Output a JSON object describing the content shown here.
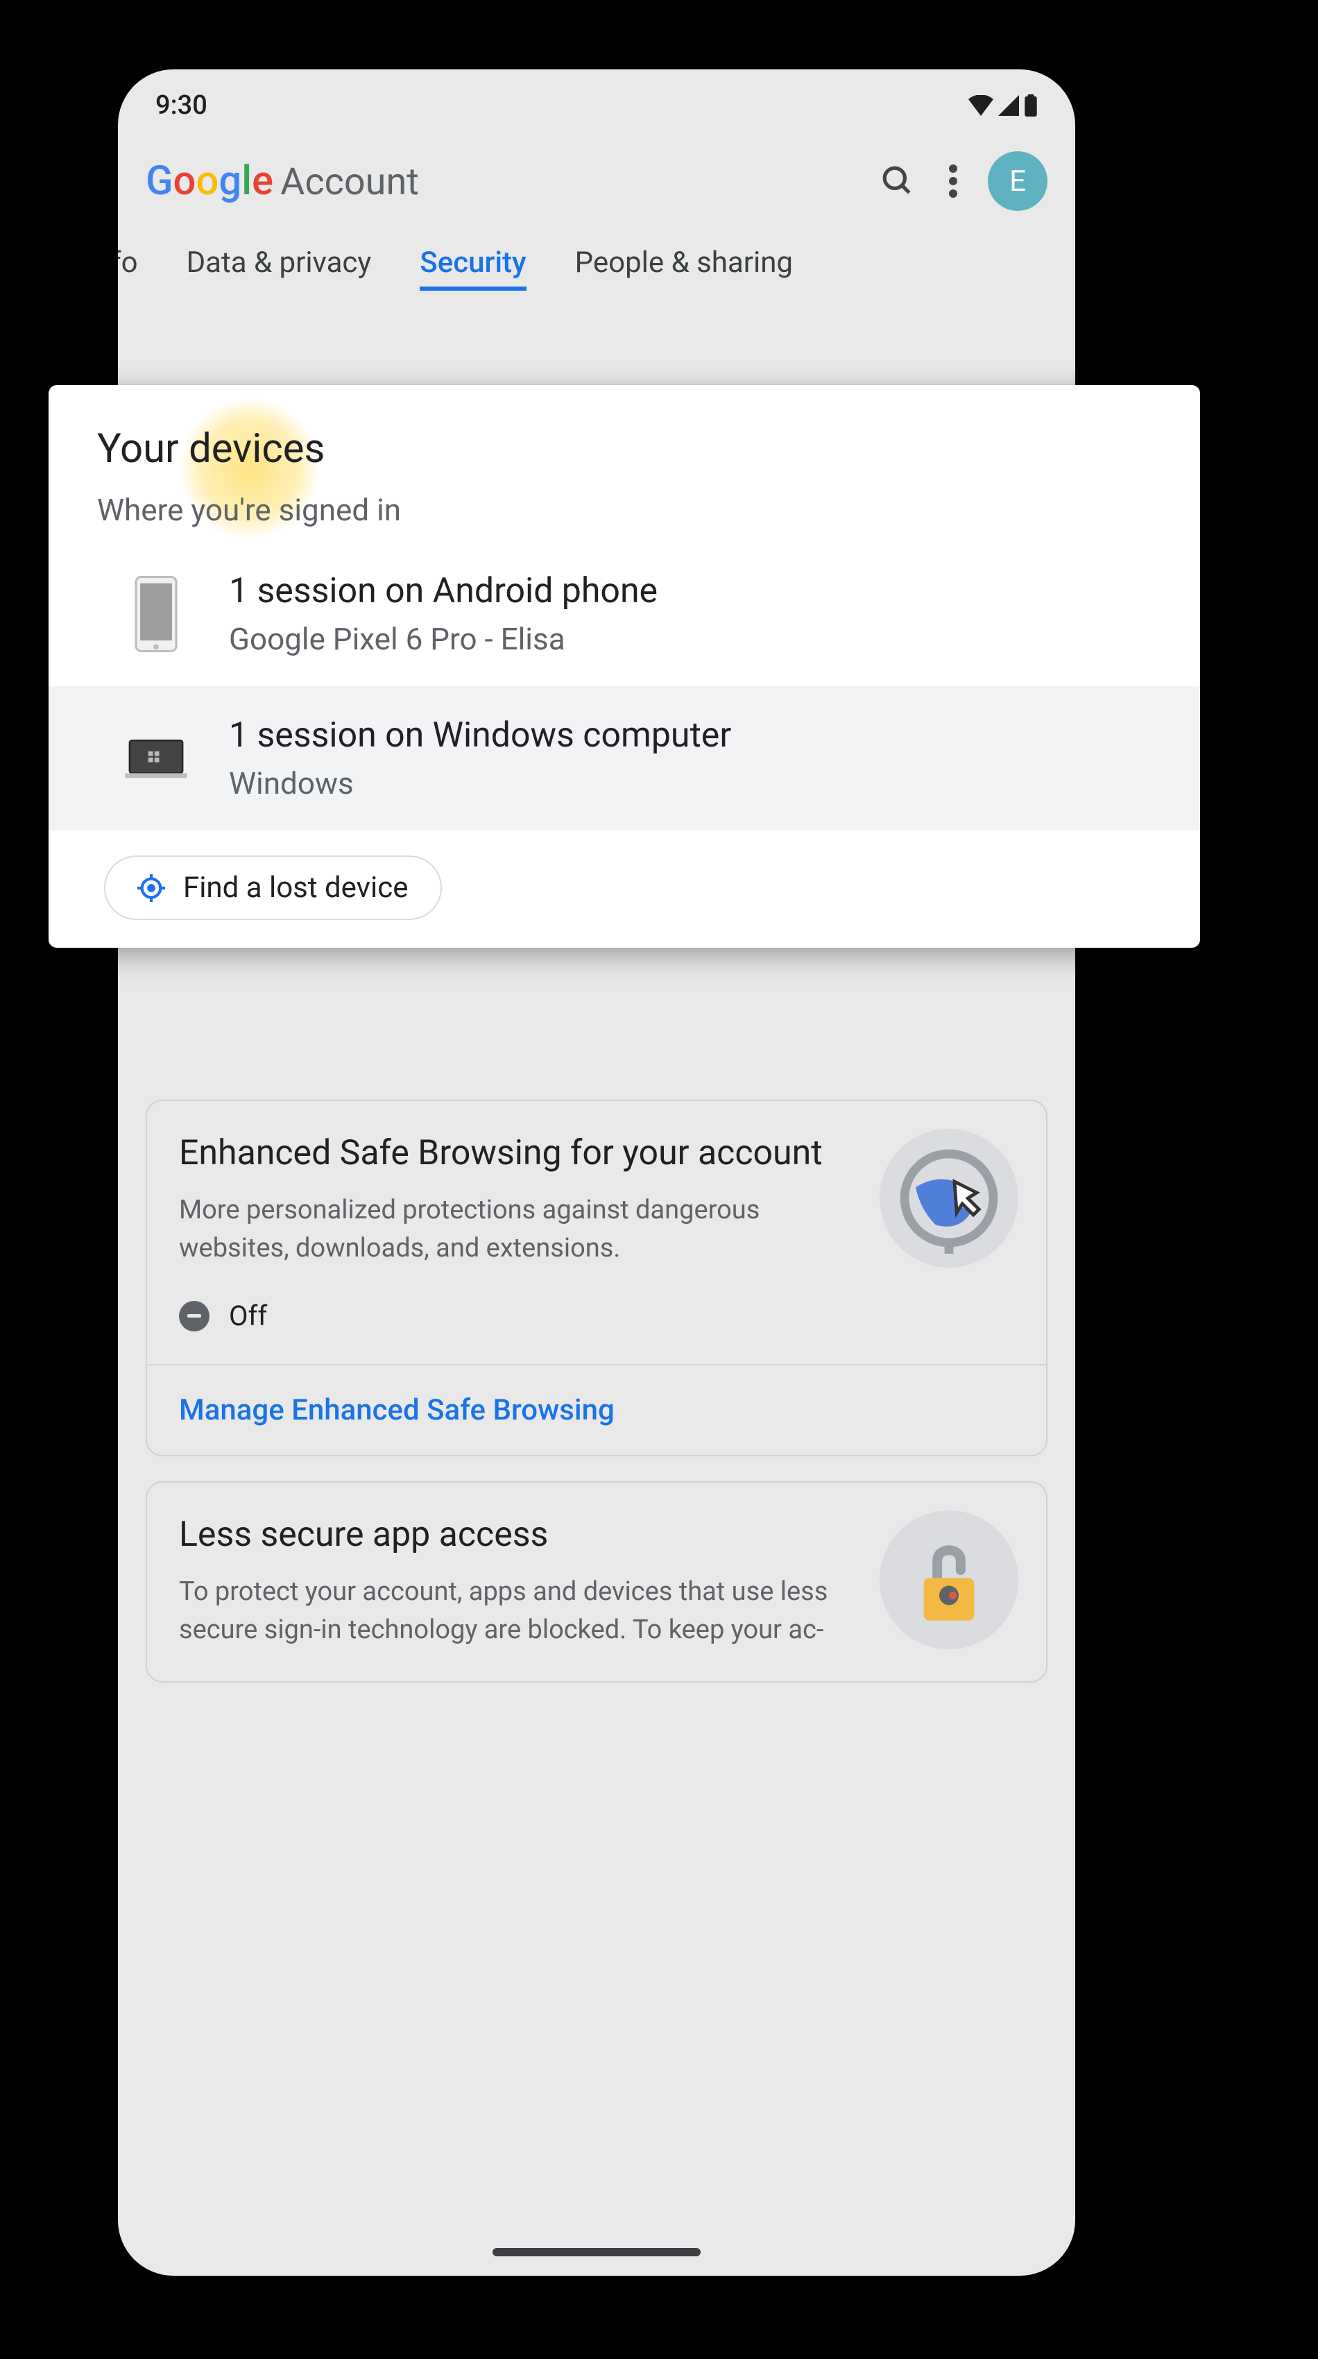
{
  "status": {
    "time": "9:30"
  },
  "header": {
    "account_label": "Account",
    "avatar_letter": "E"
  },
  "tabs": {
    "partial": "fo",
    "data_privacy": "Data & privacy",
    "security": "Security",
    "people_sharing": "People & sharing"
  },
  "overlay": {
    "title": "Your devices",
    "subtitle": "Where you're signed in",
    "devices": [
      {
        "primary": "1 session on Android phone",
        "secondary": "Google Pixel 6 Pro - Elisa"
      },
      {
        "primary": "1 session on Windows computer",
        "secondary": "Windows"
      }
    ],
    "find_label": "Find a lost device"
  },
  "cards": {
    "safe_browsing": {
      "title": "Enhanced Safe Browsing for your account",
      "desc": "More personalized protections against dangerous websites, downloads, and extensions.",
      "status": "Off",
      "link": "Manage Enhanced Safe Browsing"
    },
    "less_secure": {
      "title": "Less secure app access",
      "desc": "To protect your account, apps and devices that use less secure sign-in technology are blocked. To keep your ac-"
    }
  }
}
